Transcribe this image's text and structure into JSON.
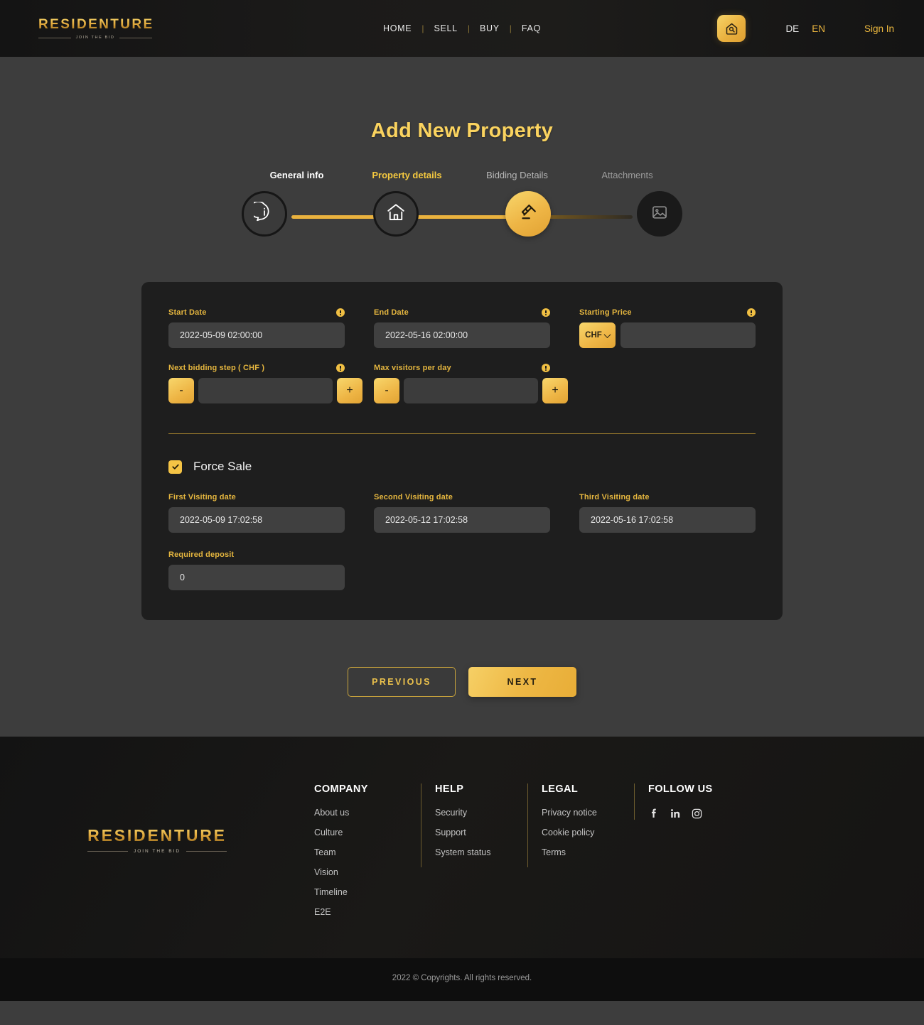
{
  "header": {
    "logo": {
      "name": "RESIDENTURE",
      "tagline": "JOIN THE BID"
    },
    "nav": [
      {
        "label": "HOME"
      },
      {
        "label": "SELL"
      },
      {
        "label": "BUY"
      },
      {
        "label": "FAQ"
      }
    ],
    "separator": "|",
    "search_icon": "house-search-icon",
    "languages": {
      "de": "DE",
      "en": "EN",
      "active": "EN"
    },
    "signin": "Sign In"
  },
  "page": {
    "title": "Add New Property"
  },
  "stepper": {
    "steps": [
      {
        "label": "General info",
        "icon": "info-icon",
        "state": "done"
      },
      {
        "label": "Property details",
        "icon": "home-icon",
        "state": "done"
      },
      {
        "label": "Bidding Details",
        "icon": "gavel-icon",
        "state": "active"
      },
      {
        "label": "Attachments",
        "icon": "image-icon",
        "state": "todo"
      }
    ]
  },
  "form": {
    "start_date": {
      "label": "Start Date",
      "value": "2022-05-09 02:00:00"
    },
    "end_date": {
      "label": "End Date",
      "value": "2022-05-16 02:00:00"
    },
    "starting_price": {
      "label": "Starting Price",
      "currency": "CHF",
      "value": ""
    },
    "next_bidding_step": {
      "label": "Next bidding step ( CHF )",
      "value": "",
      "minus": "-",
      "plus": "+"
    },
    "max_visitors": {
      "label": "Max visitors per day",
      "value": "",
      "minus": "-",
      "plus": "+"
    },
    "force_sale": {
      "label": "Force Sale",
      "checked": true
    },
    "first_visiting": {
      "label": "First Visiting date",
      "value": "2022-05-09 17:02:58"
    },
    "second_visiting": {
      "label": "Second Visiting date",
      "value": "2022-05-12 17:02:58"
    },
    "third_visiting": {
      "label": "Third Visiting date",
      "value": "2022-05-16 17:02:58"
    },
    "required_deposit": {
      "label": "Required deposit",
      "value": "0"
    }
  },
  "actions": {
    "previous": "PREVIOUS",
    "next": "NEXT"
  },
  "footer": {
    "logo": {
      "name": "RESIDENTURE",
      "tagline": "JOIN THE BID"
    },
    "columns": [
      {
        "title": "COMPANY",
        "links": [
          "About us",
          "Culture",
          "Team",
          "Vision",
          "Timeline",
          "E2E"
        ]
      },
      {
        "title": "HELP",
        "links": [
          "Security",
          "Support",
          "System status"
        ]
      },
      {
        "title": "LEGAL",
        "links": [
          "Privacy notice",
          "Cookie policy",
          "Terms"
        ]
      }
    ],
    "follow": {
      "title": "FOLLOW US",
      "icons": [
        "facebook-icon",
        "linkedin-icon",
        "instagram-icon"
      ]
    },
    "copyright": "2022 © Copyrights. All rights reserved."
  },
  "colors": {
    "accent": "#edb93f",
    "accent_light": "#fad35f",
    "page_bg": "#3d3d3d",
    "card_bg": "#1e1e1e",
    "header_bg": "#141414"
  }
}
